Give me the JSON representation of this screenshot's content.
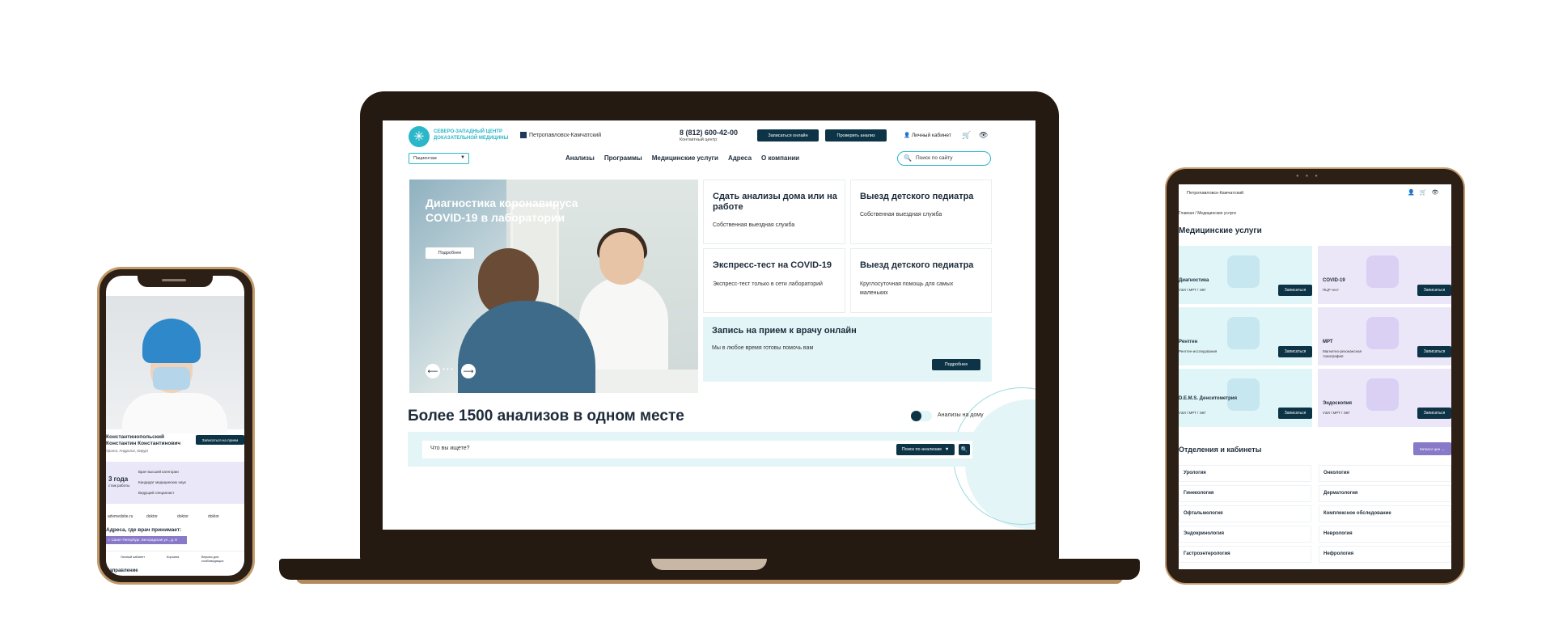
{
  "laptop": {
    "logo_text": "СЕВЕРО-ЗАПАДНЫЙ ЦЕНТР ДОКАЗАТЕЛЬНОЙ МЕДИЦИНЫ",
    "city": "Петропавловск-Камчатский",
    "phone": "8 (812) 600-42-00",
    "phone_sub": "Контактный центр",
    "btn_book": "Записаться онлайн",
    "btn_check": "Проверить анализ",
    "account": "Личный кабинет",
    "select_value": "Пациентам",
    "nav": [
      "Анализы",
      "Программы",
      "Медицинские услуги",
      "Адреса",
      "О компании"
    ],
    "search_placeholder": "Поиск по сайту",
    "hero": {
      "title": "Диагностика коронавируса COVID-19 в лаборатории",
      "btn": "Подробнее",
      "prev": "⟵",
      "next": "⟶",
      "dots": "• • •"
    },
    "cards": [
      {
        "title": "Сдать анализы дома или на работе",
        "sub": "Собственная выездная служба"
      },
      {
        "title": "Выезд детского педиатра",
        "sub": "Собственная выездная служба"
      },
      {
        "title": "Экспресс-тест на COVID-19",
        "sub": "Экспресс-тест только в сети лабораторий"
      },
      {
        "title": "Выезд детского педиатра",
        "sub": "Круглосуточная помощь для самых маленьких"
      }
    ],
    "wide_card": {
      "title": "Запись на прием к врачу онлайн",
      "sub": "Мы в любое время готовы помочь вам",
      "btn": "Подробнее"
    },
    "section_title": "Более 1500 анализов в одном месте",
    "toggle_label": "Анализы на дому",
    "search_question": "Что вы ищете?",
    "search_select": "Поиск по анализам"
  },
  "phone": {
    "name": "Константинопольский Константин Константинович",
    "specialty": "Уролог, Андролог, Хирург",
    "btn": "Записаться на прием",
    "years": "3 года",
    "years_sub": "стаж работы",
    "features": [
      "Врач высшей категории",
      "Кандидат медицинских наук",
      "Ведущий специалист"
    ],
    "socials": [
      "advmedsite.ru",
      "doktor",
      "doktor",
      "doktor"
    ],
    "address_title": "Адреса, где врач принимает:",
    "address": "г. Санкт-Петербург, Белградская ул., д. 8",
    "bottom_items": [
      "Личный кабинет",
      "Корзина",
      "Версия для слабовидящих"
    ],
    "direction": "Направление"
  },
  "tablet": {
    "city": "Петропавловск-Камчатский",
    "breadcrumb": "Главная / Медицинские услуги",
    "title": "Медицинские услуги",
    "book_btn": "Записаться",
    "services": [
      {
        "name": "Диагностика",
        "sub": "УЗИ / МРТ / ЭКГ",
        "color": "#dff5f7"
      },
      {
        "name": "COVID-19",
        "sub": "ПЦР-тест",
        "color": "#ece7f8"
      },
      {
        "name": "Рентген",
        "sub": "Рентген-исследования",
        "color": "#dff5f7"
      },
      {
        "name": "МРТ",
        "sub": "Магнитно-резонансная томография",
        "color": "#ece7f8"
      },
      {
        "name": "D.E.M.S. Денситометрия",
        "sub": "УЗИ / МРТ / ЭКГ",
        "color": "#dff5f7"
      },
      {
        "name": "Эндоскопия",
        "sub": "УЗИ / МРТ / ЭКГ",
        "color": "#ece7f8"
      }
    ],
    "dept_title": "Отделения и кабинеты",
    "catalog_btn": "Каталог цен →",
    "departments": [
      "Урология",
      "Онкология",
      "Гинекология",
      "Дерматология",
      "Офтальмология",
      "Комплексное обследование",
      "Эндокринология",
      "Неврология",
      "Гастроэнтерология",
      "Нефрология"
    ]
  },
  "colors": {
    "accent": "#2bb7c9",
    "dark": "#0d3446",
    "light": "#e4f5f7",
    "violet": "#8879c9"
  }
}
